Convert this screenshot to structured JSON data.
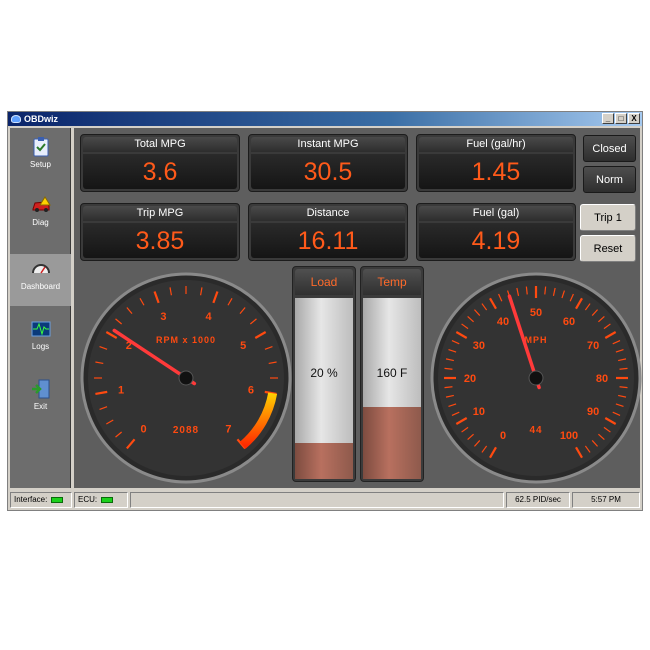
{
  "window": {
    "title": "OBDwiz"
  },
  "titlebar_buttons": [
    "_",
    "□",
    "X"
  ],
  "sidebar": {
    "items": [
      {
        "label": "Setup",
        "icon": "clipboard-check-icon",
        "active": false
      },
      {
        "label": "Diag",
        "icon": "car-warning-icon",
        "active": false
      },
      {
        "label": "Dashboard",
        "icon": "gauge-icon",
        "active": true
      },
      {
        "label": "Logs",
        "icon": "waveform-icon",
        "active": false
      },
      {
        "label": "Exit",
        "icon": "exit-door-icon",
        "active": false
      }
    ]
  },
  "tiles": [
    {
      "label": "Total MPG",
      "value": "3.6"
    },
    {
      "label": "Instant MPG",
      "value": "30.5"
    },
    {
      "label": "Fuel (gal/hr)",
      "value": "1.45"
    },
    {
      "label": "Trip MPG",
      "value": "3.85"
    },
    {
      "label": "Distance",
      "value": "16.11"
    },
    {
      "label": "Fuel (gal)",
      "value": "4.19"
    }
  ],
  "buttons": {
    "closed": "Closed",
    "norm": "Norm",
    "trip": "Trip 1",
    "reset": "Reset"
  },
  "rpm_gauge": {
    "label": "RPM x 1000",
    "readout": "2088",
    "ticks": [
      "0",
      "1",
      "2",
      "3",
      "4",
      "5",
      "6",
      "7"
    ],
    "min": 0,
    "max": 7,
    "value": 2.088,
    "redline_from": 6,
    "accent": "#ff4a10"
  },
  "speed_gauge": {
    "label": "MPH",
    "readout": "44",
    "ticks": [
      "0",
      "10",
      "20",
      "30",
      "40",
      "50",
      "60",
      "70",
      "80",
      "90",
      "100"
    ],
    "min": 0,
    "max": 100,
    "value": 44,
    "accent": "#ff4a10"
  },
  "bars": [
    {
      "label": "Load",
      "value_text": "20 %",
      "fraction": 0.2
    },
    {
      "label": "Temp",
      "value_text": "160 F",
      "fraction": 0.4
    }
  ],
  "status": {
    "interface_label": "Interface:",
    "ecu_label": "ECU:",
    "rate": "62.5 PID/sec",
    "time": "5:57 PM"
  },
  "colors": {
    "led": "#1cd01c",
    "value_text": "#ff5a1a",
    "needle": "#ff3a3a"
  }
}
